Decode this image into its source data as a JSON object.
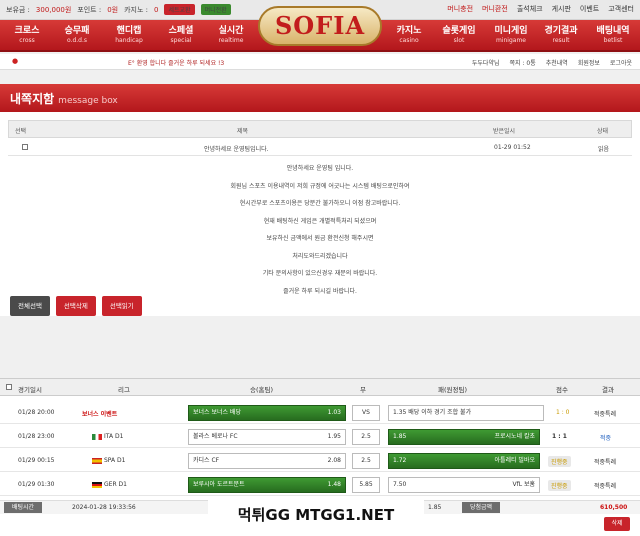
{
  "topbar": {
    "balance_label": "보유금 :",
    "balance_value": "300,000원",
    "point_label": "포인트 :",
    "point_value": "0원",
    "casino_label": "카지노 :",
    "casino_value": "0",
    "btn1": "세트교환",
    "btn2": "머니전환",
    "right_links": [
      "머니충전",
      "머니환전",
      "출석체크",
      "게시판",
      "이벤트",
      "고객센터"
    ]
  },
  "logo": "SOFIA",
  "nav": [
    {
      "ko": "크로스",
      "en": "cross"
    },
    {
      "ko": "승무패",
      "en": "o.d.d.s"
    },
    {
      "ko": "핸디캡",
      "en": "handicap"
    },
    {
      "ko": "스페셜",
      "en": "special"
    },
    {
      "ko": "실시간",
      "en": "realtime"
    },
    {
      "ko": "카지노",
      "en": "casino"
    },
    {
      "ko": "슬롯게임",
      "en": "slot"
    },
    {
      "ko": "미니게임",
      "en": "minigame"
    },
    {
      "ko": "경기결과",
      "en": "result"
    },
    {
      "ko": "배팅내역",
      "en": "betlist"
    }
  ],
  "subbar": {
    "ticker": "E° 환영 합니다 즐거운 하루 되세요 !3",
    "links": [
      "두두다약님",
      "쪽지 : 0통",
      "추천내역",
      "회원정보",
      "로그아웃"
    ]
  },
  "msgbox": {
    "title": "내쪽지함",
    "subtitle": "message box",
    "headers": [
      "선택",
      "제목",
      "받은일시",
      "상태"
    ],
    "row": {
      "title": "안녕하세요 운영팀입니다.",
      "date": "01-29 01:52",
      "status": "읽음"
    },
    "body": [
      "안녕하세요 운영팀 입니다.",
      "회원님 스포츠 이용내역이 저희 규정에 어긋나는 시스템 배팅으로인하여",
      "현시간부로 스포츠이용은 당분간 불가하오니 이점 참고바랍니다.",
      "현재 배팅하신 게임은 개별적특처리 되셨으며",
      "보유하신 금액에서 원금 환전신청 해주시면",
      "처리도와드리겠습니다",
      "기타 문의사항이 있으신경우 재문의 바랍니다.",
      "즐거운 하루 되시길 바랍니다."
    ],
    "actions": [
      "전체선택",
      "선택삭제",
      "선택읽기"
    ]
  },
  "betlist": {
    "headers": [
      "경기일시",
      "리그",
      "승(홈팀)",
      "무",
      "패(원정팀)",
      "점수",
      "결과"
    ],
    "rows": [
      {
        "date": "01/28 20:00",
        "league": "보너스 이벤트",
        "home": "보너스 보너스 배당",
        "home_odds": "1.03",
        "draw": "VS",
        "away": "1.35 배당 이하 경기 조합 불가",
        "away_odds": "1.35",
        "score": "1 : 0",
        "result": "적중특례",
        "flag": ""
      },
      {
        "date": "01/28 23:00",
        "league": "ITA D1",
        "home": "볼라스 베로나 FC",
        "home_odds": "1.95",
        "draw": "2.5",
        "away": "프로시노네 칼초",
        "away_odds": "1.85",
        "score": "1 : 1",
        "result": "적중",
        "flag": "ita"
      },
      {
        "date": "01/29 00:15",
        "league": "SPA D1",
        "home": "카디스 CF",
        "home_odds": "2.08",
        "draw": "2.5",
        "away": "아틀레티 빌바오",
        "away_odds": "1.72",
        "score": "진행중",
        "result": "적중특례",
        "flag": "spa"
      },
      {
        "date": "01/29 01:30",
        "league": "GER D1",
        "home": "보루시아 도르트문트",
        "home_odds": "1.48",
        "draw": "5.85",
        "away": "VfL 보훔",
        "away_odds": "7.50",
        "score": "진행중",
        "result": "적중특례",
        "flag": "ger"
      }
    ],
    "summary": {
      "label": "배팅시간",
      "time": "2024-01-28 19:33:56",
      "odds": "1.85",
      "win_label": "당첨금액",
      "win_value": "610,500"
    },
    "delete": "삭제"
  },
  "overlay_text": "먹튀GG MTGG1.NET",
  "colors": {
    "accent": "#c8242b",
    "green": "#3b8a2e"
  }
}
